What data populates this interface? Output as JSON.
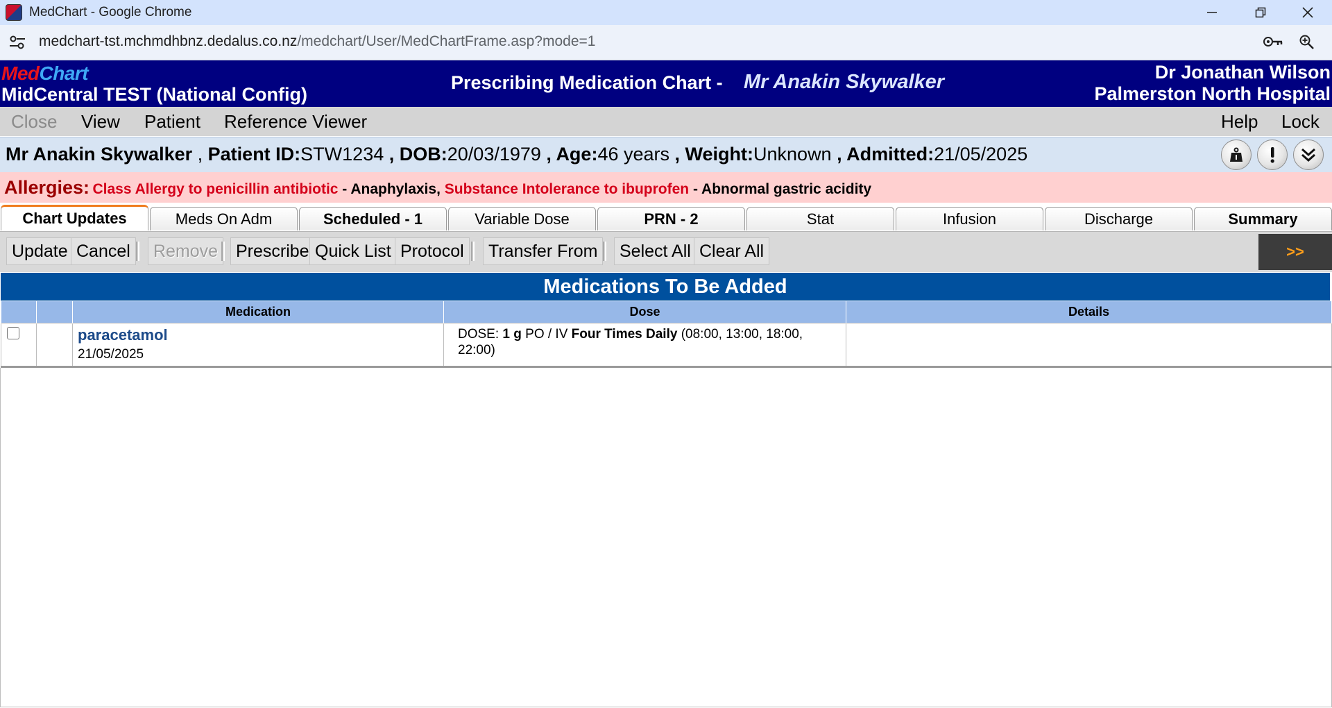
{
  "browser": {
    "window_title": "MedChart - Google Chrome",
    "url_host": "medchart-tst.mchmdhbnz.dedalus.co.nz",
    "url_path": "/medchart/User/MedChartFrame.asp?mode=1"
  },
  "header": {
    "logo_part1": "Med",
    "logo_part2": "Chart",
    "config": "MidCentral TEST (National Config)",
    "chart_title": "Prescribing Medication Chart -",
    "patient_name": "Mr Anakin Skywalker",
    "doctor": "Dr Jonathan Wilson",
    "hospital": "Palmerston North Hospital"
  },
  "menu": {
    "close": "Close",
    "view": "View",
    "patient": "Patient",
    "reference_viewer": "Reference Viewer",
    "help": "Help",
    "lock": "Lock"
  },
  "patient": {
    "name": "Mr Anakin Skywalker",
    "id_label": "Patient ID:",
    "id": "STW1234",
    "dob_label": "DOB:",
    "dob": "20/03/1979",
    "age_label": "Age:",
    "age": "46 years",
    "weight_label": "Weight:",
    "weight": "Unknown",
    "admitted_label": "Admitted:",
    "admitted": "21/05/2025"
  },
  "allergies": {
    "label": "Allergies:",
    "items": [
      {
        "name": "Class Allergy to penicillin antibiotic",
        "reaction": "Anaphylaxis"
      },
      {
        "name": "Substance Intolerance to ibuprofen",
        "reaction": "Abnormal gastric acidity"
      }
    ]
  },
  "tabs": [
    {
      "label": "Chart Updates"
    },
    {
      "label": "Meds On Adm"
    },
    {
      "label": "Scheduled - 1"
    },
    {
      "label": "Variable Dose"
    },
    {
      "label": "PRN - 2"
    },
    {
      "label": "Stat"
    },
    {
      "label": "Infusion"
    },
    {
      "label": "Discharge"
    },
    {
      "label": "Summary"
    }
  ],
  "toolbar": {
    "update": "Update",
    "cancel": "Cancel",
    "remove": "Remove",
    "prescribe": "Prescribe",
    "quick_list": "Quick List",
    "protocol": "Protocol",
    "transfer_from": "Transfer From",
    "select_all": "Select All",
    "clear_all": "Clear All",
    "more": ">>"
  },
  "meds": {
    "title": "Medications To Be Added",
    "columns": {
      "medication": "Medication",
      "dose": "Dose",
      "details": "Details"
    },
    "rows": [
      {
        "name": "paracetamol",
        "date": "21/05/2025",
        "dose_prefix": "DOSE:",
        "dose_amount": "1 g",
        "route": "PO / IV",
        "frequency": "Four Times Daily",
        "times": "(08:00, 13:00, 18:00, 22:00)",
        "details": ""
      }
    ]
  }
}
